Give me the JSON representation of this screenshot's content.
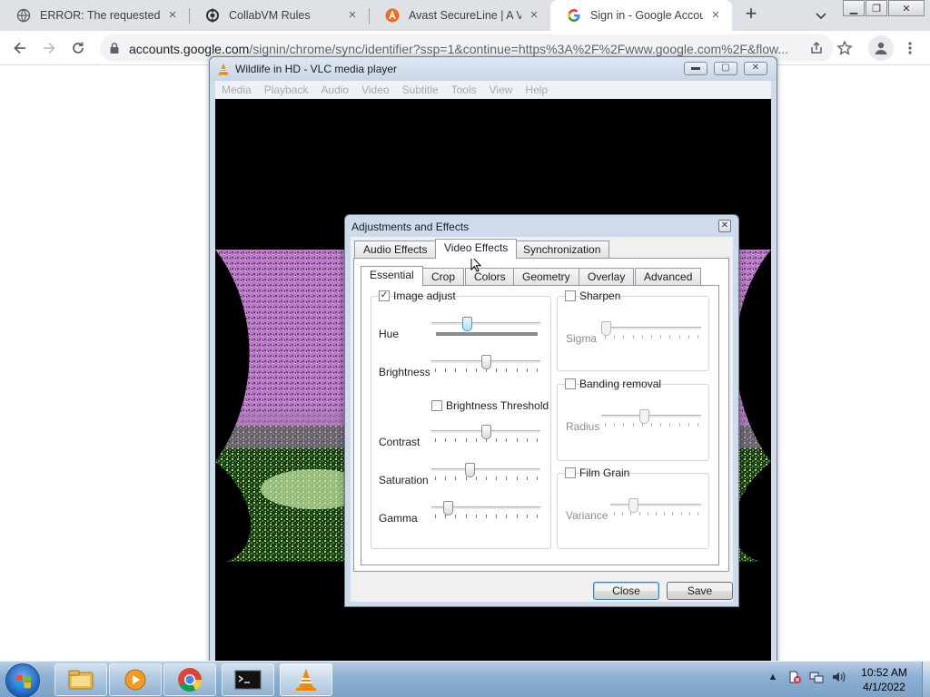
{
  "browser": {
    "tabs": [
      {
        "title": "ERROR: The requested UR",
        "favicon": "globe-icon"
      },
      {
        "title": "CollabVM Rules",
        "favicon": "collabvm-icon"
      },
      {
        "title": "Avast SecureLine | A VPN",
        "favicon": "avast-icon"
      },
      {
        "title": "Sign in - Google Account",
        "favicon": "google-icon",
        "active": true
      }
    ],
    "url_host": "accounts.google.com",
    "url_path": "/signin/chrome/sync/identifier?ssp=1&continue=https%3A%2F%2Fwww.google.com%2F&flow..."
  },
  "vlc": {
    "title": "Wildlife in HD - VLC media player",
    "menu": [
      "Media",
      "Playback",
      "Audio",
      "Video",
      "Subtitle",
      "Tools",
      "View",
      "Help"
    ]
  },
  "dialog": {
    "title": "Adjustments and Effects",
    "main_tabs": [
      "Audio Effects",
      "Video Effects",
      "Synchronization"
    ],
    "sub_tabs": [
      "Essential",
      "Crop",
      "Colors",
      "Geometry",
      "Overlay",
      "Advanced"
    ],
    "image_adjust": {
      "label": "Image adjust",
      "checked": true,
      "hue": {
        "label": "Hue",
        "value": 0.31
      },
      "brightness": {
        "label": "Brightness",
        "value": 0.5
      },
      "brightness_threshold": {
        "label": "Brightness Threshold",
        "checked": false
      },
      "contrast": {
        "label": "Contrast",
        "value": 0.5
      },
      "saturation": {
        "label": "Saturation",
        "value": 0.34
      },
      "gamma": {
        "label": "Gamma",
        "value": 0.12
      }
    },
    "sharpen": {
      "label": "Sharpen",
      "checked": false,
      "sigma": {
        "label": "Sigma",
        "value": 0.0
      }
    },
    "banding": {
      "label": "Banding removal",
      "checked": false,
      "radius": {
        "label": "Radius",
        "value": 0.42
      }
    },
    "film_grain": {
      "label": "Film Grain",
      "checked": false,
      "variance": {
        "label": "Variance",
        "value": 0.22
      }
    },
    "close_label": "Close",
    "save_label": "Save"
  },
  "taskbar": {
    "items": [
      "explorer-icon",
      "media-player-icon",
      "chrome-icon",
      "cmd-icon",
      "vlc-icon"
    ],
    "time": "10:52 AM",
    "date": "4/1/2022"
  }
}
